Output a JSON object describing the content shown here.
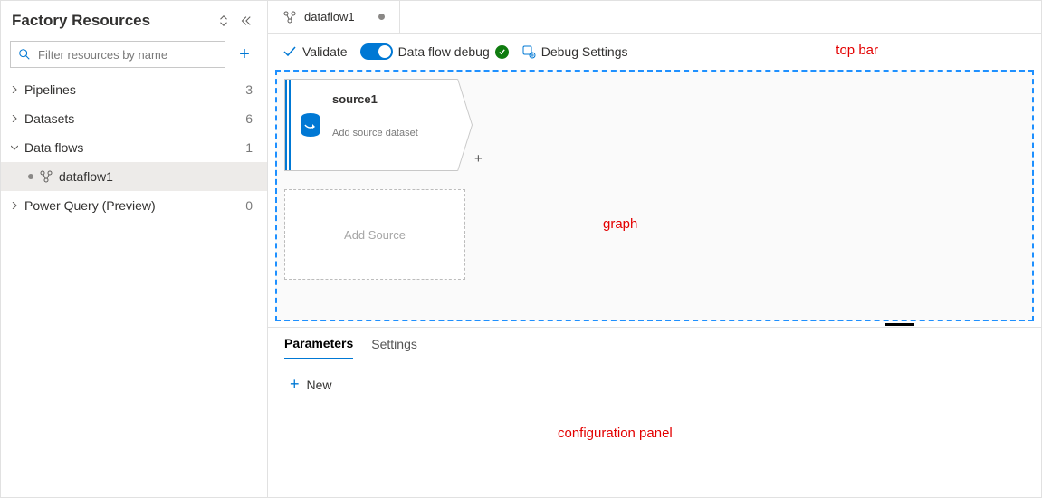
{
  "sidebar": {
    "title": "Factory Resources",
    "filter_placeholder": "Filter resources by name",
    "sections": [
      {
        "label": "Pipelines",
        "count": "3",
        "expanded": false
      },
      {
        "label": "Datasets",
        "count": "6",
        "expanded": false
      },
      {
        "label": "Data flows",
        "count": "1",
        "expanded": true
      },
      {
        "label": "Power Query (Preview)",
        "count": "0",
        "expanded": false
      }
    ],
    "dataflows_child": "dataflow1"
  },
  "tab": {
    "label": "dataflow1"
  },
  "toolbar": {
    "validate": "Validate",
    "debug_label": "Data flow debug",
    "debug_on": true,
    "debug_settings": "Debug Settings"
  },
  "annotations": {
    "top_bar": "top bar",
    "graph": "graph",
    "config_panel": "configuration panel"
  },
  "graph": {
    "source_title": "source1",
    "source_sub": "Add source dataset",
    "add_source": "Add Source"
  },
  "config": {
    "tabs": [
      {
        "label": "Parameters",
        "active": true
      },
      {
        "label": "Settings",
        "active": false
      }
    ],
    "new_label": "New"
  }
}
